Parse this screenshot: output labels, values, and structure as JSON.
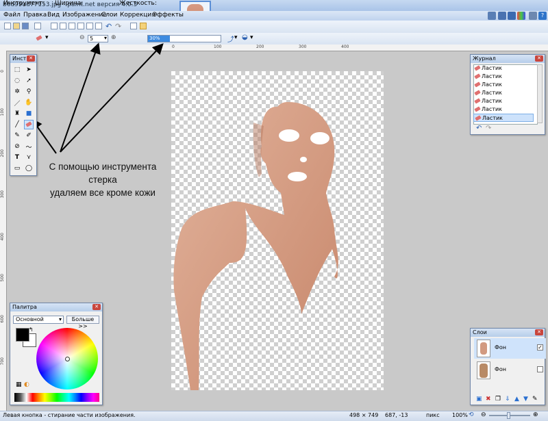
{
  "window": {
    "title": "b6d99ad77153.jpg - paint.net версия 4.0.3"
  },
  "menu": [
    "Файл",
    "Правка",
    "Вид",
    "Изображение",
    "Слои",
    "Коррекция",
    "Эффекты"
  ],
  "toolbar": {
    "tool_label": "Инструмент:",
    "width_label": "Ширина:",
    "width_value": "5",
    "hardness_label": "Жесткость:",
    "hardness_value": "30%",
    "hardness_fraction": 0.3
  },
  "ruler": {
    "top_ticks": [
      "0",
      "100",
      "200",
      "300",
      "400"
    ],
    "left_ticks": [
      "0",
      "100",
      "200",
      "300",
      "400",
      "500",
      "600",
      "700"
    ]
  },
  "tools_panel": {
    "title": "Инст..."
  },
  "annotation": {
    "lines": [
      "С помощью инструмента",
      "стерка",
      "удаляем все кроме кожи"
    ]
  },
  "history_panel": {
    "title": "Журнал",
    "items": [
      "Ластик",
      "Ластик",
      "Ластик",
      "Ластик",
      "Ластик",
      "Ластик",
      "Ластик"
    ]
  },
  "palette_panel": {
    "title": "Палитра",
    "mode_value": "Основной",
    "more_button": "Больше >>"
  },
  "layers_panel": {
    "title": "Слои",
    "layers": [
      {
        "name": "Фон",
        "visible": true
      },
      {
        "name": "Фон",
        "visible": false
      }
    ]
  },
  "statusbar": {
    "hint": "Левая кнопка - стирание части изображения.",
    "size": "498 × 749",
    "coords": "687, -13",
    "units": "пикс",
    "zoom": "100%"
  },
  "colors": {
    "accent": "#3d8be0",
    "primary": "#000000",
    "secondary": "#ffffff"
  }
}
